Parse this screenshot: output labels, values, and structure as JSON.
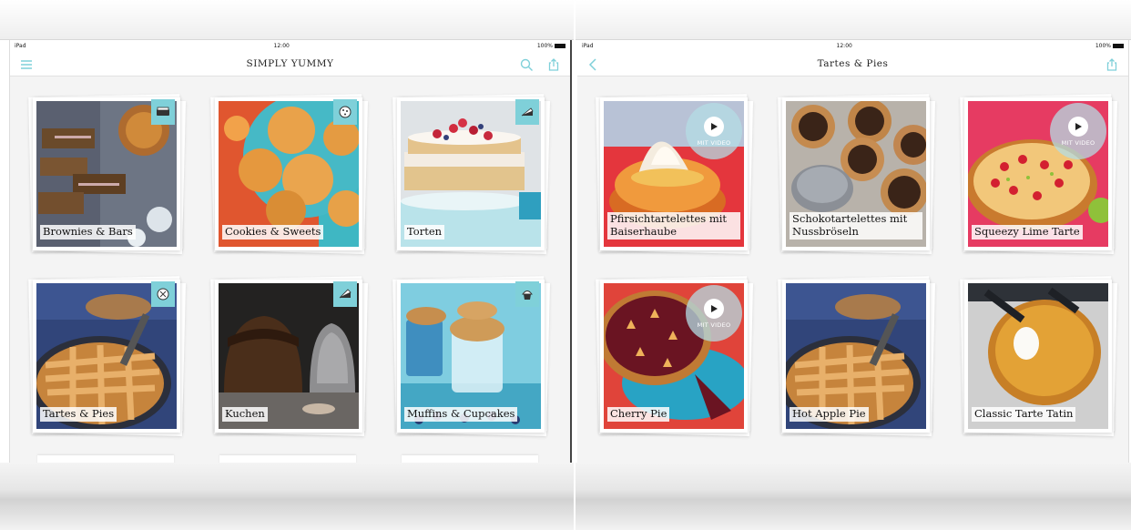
{
  "left": {
    "status": {
      "device": "iPad",
      "time": "12:00",
      "battery": "100%"
    },
    "title": "SIMPLY YUMMY",
    "icons": {
      "menu": "hamburger-menu-icon",
      "search": "search-icon",
      "share": "share-icon"
    },
    "categories": [
      {
        "label": "Brownies & Bars",
        "icon": "brownie-icon"
      },
      {
        "label": "Cookies & Sweets",
        "icon": "cookie-icon"
      },
      {
        "label": "Torten",
        "icon": "cake-slice-icon"
      },
      {
        "label": "Tartes & Pies",
        "icon": "pie-icon"
      },
      {
        "label": "Kuchen",
        "icon": "cake-piece-icon"
      },
      {
        "label": "Muffins & Cupcakes",
        "icon": "cupcake-icon"
      }
    ]
  },
  "right": {
    "status": {
      "device": "iPad",
      "time": "12:00",
      "battery": "100%"
    },
    "title": "Tartes & Pies",
    "icons": {
      "back": "back-chevron-icon",
      "share": "share-icon"
    },
    "recipes": [
      {
        "label": "Pfirsichtartelettes mit Baiserhaube",
        "video": true
      },
      {
        "label": "Schokotartelettes mit Nussbröseln",
        "video": false
      },
      {
        "label": "Squeezy Lime Tarte",
        "video": true
      },
      {
        "label": "Cherry Pie",
        "video": true
      },
      {
        "label": "Hot Apple Pie",
        "video": false
      },
      {
        "label": "Classic Tarte Tatin",
        "video": false
      }
    ],
    "video_badge": "MIT VIDEO"
  },
  "colors": {
    "accent": "#7fd0d9",
    "background": "#f4f4f4"
  }
}
